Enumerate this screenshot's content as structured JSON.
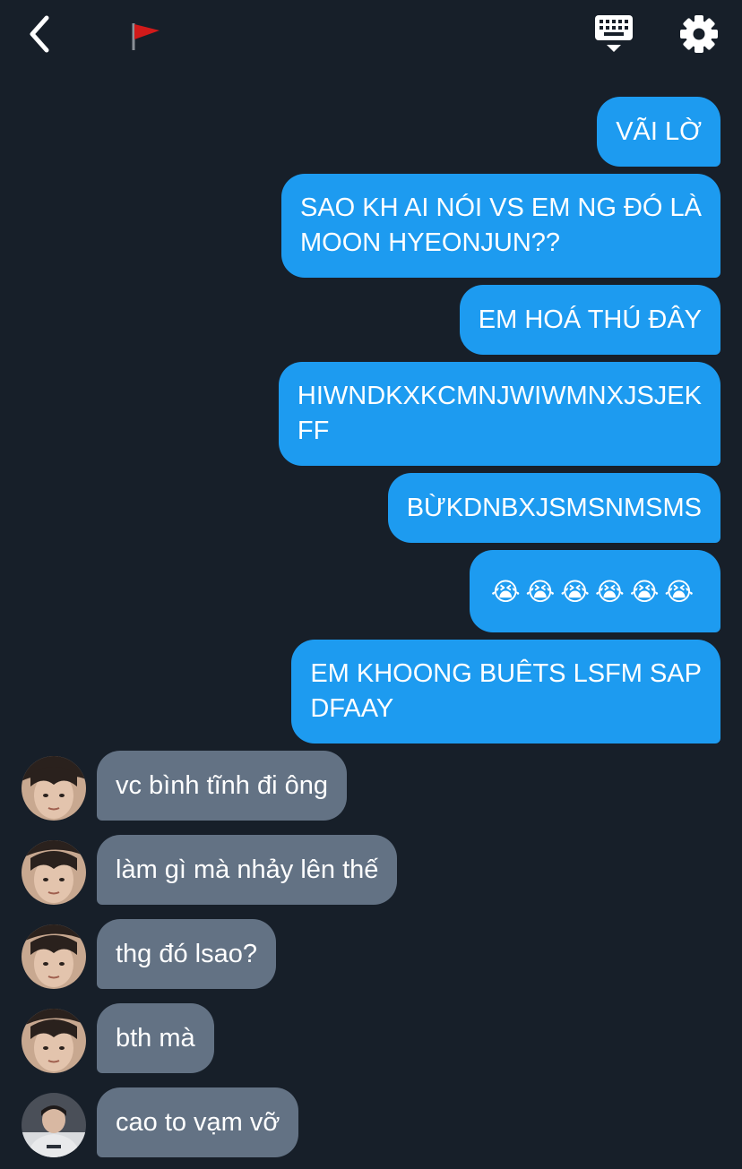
{
  "header": {
    "back_icon": "chevron-left-icon",
    "flag_icon": "red-flag-icon",
    "keyboard_icon": "keyboard-icon",
    "settings_icon": "gear-icon"
  },
  "colors": {
    "background": "#171f29",
    "outgoing_bubble": "#1d9bf0",
    "incoming_bubble": "#637284",
    "text": "#ffffff"
  },
  "messages": [
    {
      "from": "me",
      "text": "VÃI LỜ"
    },
    {
      "from": "me",
      "text": "SAO KH AI NÓI VS EM NG ĐÓ LÀ\nMOON HYEONJUN??"
    },
    {
      "from": "me",
      "text": "EM HOÁ THÚ ĐÂY"
    },
    {
      "from": "me",
      "text": "HIWNDKXKCMNJWIWMNXJSJEK\nFF"
    },
    {
      "from": "me",
      "text": "BỪKDNBXJSMSNMSMS"
    },
    {
      "from": "me",
      "text": "😭😭😭😭😭😭"
    },
    {
      "from": "me",
      "text": "EM KHOONG BUÊTS LSFM SAP\nDFAAY"
    },
    {
      "from": "them",
      "text": "vc bình tĩnh đi ông"
    },
    {
      "from": "them",
      "text": "làm gì mà nhảy lên thế"
    },
    {
      "from": "them",
      "text": "thg đó lsao?"
    },
    {
      "from": "them",
      "text": "bth mà"
    },
    {
      "from": "them",
      "text": "cao to vạm vỡ"
    }
  ]
}
